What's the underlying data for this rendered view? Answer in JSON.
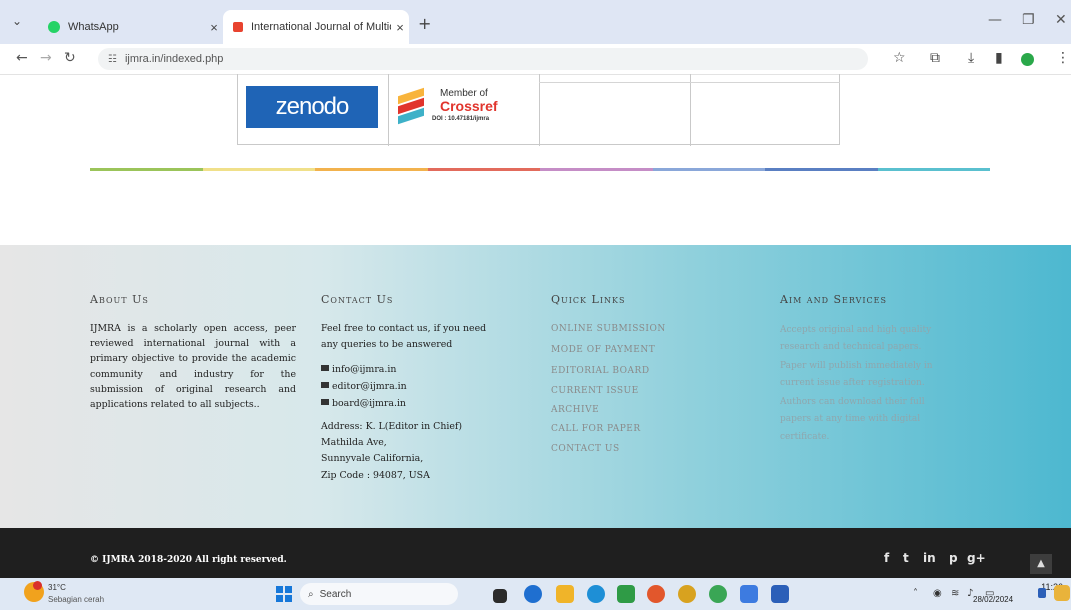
{
  "browser": {
    "tabs": [
      {
        "title": "WhatsApp",
        "color": "#25D366"
      },
      {
        "title": "International Journal of Multidi",
        "color": "#e8432f"
      }
    ],
    "url": "ijmra.in/indexed.php"
  },
  "logos": {
    "zenodo": "zenodo",
    "crossref_member": "Member of",
    "crossref_name": "Crossref",
    "crossref_doi": "DOI : 10.47181/ijmra"
  },
  "footer": {
    "about": {
      "title": "About Us",
      "text": "IJMRA is a scholarly open access, peer reviewed international journal with a primary objective to provide the academic community and industry for the submission of original research and applications related to all subjects.."
    },
    "contact": {
      "title": "Contact Us",
      "intro": [
        "Feel free to contact us, if you need",
        "any queries to be answered"
      ],
      "emails": [
        "info@ijmra.in",
        "editor@ijmra.in",
        "board@ijmra.in"
      ],
      "address": [
        "Address: K. L(Editor in Chief)",
        "Mathilda Ave,",
        "Sunnyvale California,",
        "Zip Code : 94087, USA"
      ]
    },
    "quick_links": {
      "title": "Quick Links",
      "items": [
        "ONLINE SUBMISSION",
        "MODE OF PAYMENT",
        "EDITORIAL BOARD",
        "CURRENT ISSUE",
        "ARCHIVE",
        "CALL FOR PAPER",
        "CONTACT US"
      ]
    },
    "aim": {
      "title": "Aim and Services",
      "lines": [
        "Accepts original and high quality",
        "research and technical papers.",
        "Paper will publish immediately in",
        "current issue after registration.",
        "Authors can download their full",
        "papers at any time with digital",
        "certificate."
      ]
    },
    "copyright": "© IJMRA 2018-2020 All right reserved.",
    "social": [
      "f",
      "t",
      "in",
      "p",
      "g+"
    ]
  },
  "taskbar": {
    "temperature": "31°C",
    "weather": "Sebagian cerah",
    "search_placeholder": "Search",
    "time": "11:26",
    "date": "28/02/2024"
  }
}
